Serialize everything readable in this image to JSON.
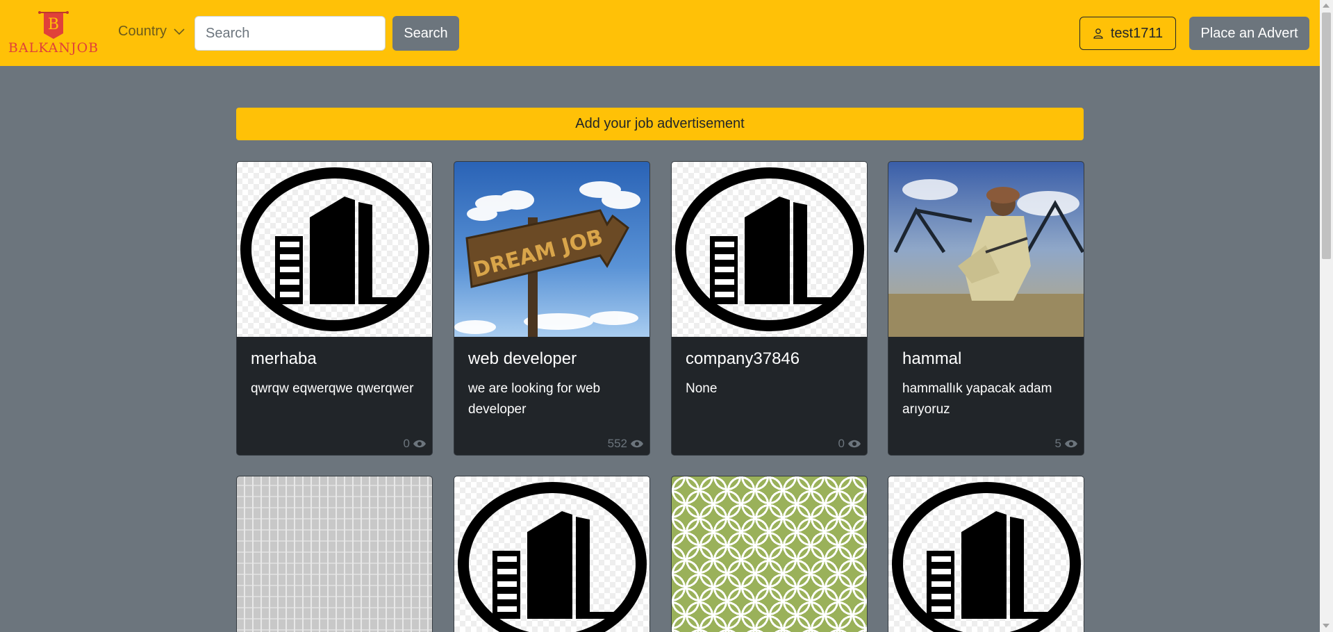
{
  "header": {
    "brand_letter": "B",
    "brand_name": "BALKANJOB",
    "country_label": "Country",
    "search_placeholder": "Search",
    "search_button": "Search",
    "user_label": "test1711",
    "place_advert": "Place an Advert"
  },
  "banner": {
    "label": "Add your job advertisement"
  },
  "jobs": [
    {
      "title": "merhaba",
      "description": "qwrqw eqwerqwe qwerqwer",
      "views": "0",
      "image": "company-logo"
    },
    {
      "title": "web developer",
      "description": "we are looking for web developer",
      "views": "552",
      "image": "dream-job-sign"
    },
    {
      "title": "company37846",
      "description": "None",
      "views": "0",
      "image": "company-logo"
    },
    {
      "title": "hammal",
      "description": "hammallık yapacak adam arıyoruz",
      "views": "5",
      "image": "worker-photo"
    }
  ],
  "row2": [
    {
      "image": "gray-pattern"
    },
    {
      "image": "company-logo"
    },
    {
      "image": "green-circles-pattern"
    },
    {
      "image": "company-logo"
    }
  ],
  "colors": {
    "navbar": "#ffc107",
    "page": "#6c757d",
    "card": "#212529"
  }
}
